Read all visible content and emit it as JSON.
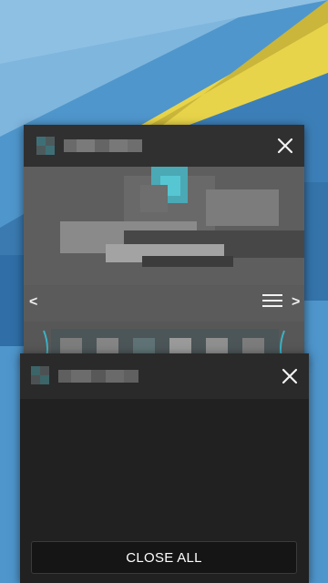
{
  "recents": {
    "cards": [
      {
        "app_title_redacted": true,
        "thumbnail_redacted": true
      },
      {
        "app_title_redacted": true,
        "thumbnail_redacted": false
      }
    ]
  },
  "close_all_label": "CLOSE ALL",
  "icons": {
    "close": "close-icon",
    "menu": "hamburger-menu-icon",
    "left": "chevron-left-icon",
    "right": "chevron-right-icon"
  },
  "colors": {
    "wallpaper_blue": "#4f96cc",
    "wallpaper_yellow": "#e8d44a",
    "card_dark": "#212121",
    "accent_teal": "#3ab2c4"
  },
  "arrows": {
    "left": "<",
    "right": ">"
  }
}
